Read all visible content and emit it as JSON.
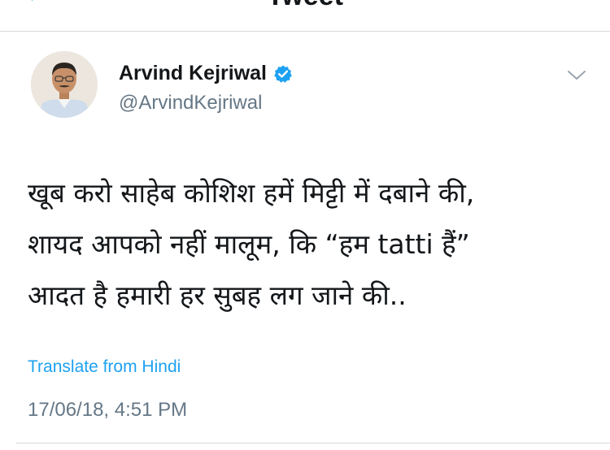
{
  "nav": {
    "title": "Tweet"
  },
  "tweet": {
    "author_name": "Arvind Kejriwal",
    "author_handle": "@ArvindKejriwal",
    "lines": [
      "खूब करो साहेब कोशिश हमें मिट्टी में दबाने की,",
      "शायद आपको नहीं मालूम, कि “हम tatti हैं”",
      "आदत है हमारी हर सुबह लग जाने की.."
    ],
    "translate_label": "Translate from Hindi",
    "timestamp": "17/06/18, 4:51 PM"
  },
  "icons": {
    "back": "chevron-left-icon",
    "verified": "verified-badge-icon",
    "menu": "chevron-down-icon"
  },
  "colors": {
    "accent": "#1da1f2",
    "text": "#14171a",
    "secondary_text": "#657786",
    "divider": "#d9d9d9"
  }
}
